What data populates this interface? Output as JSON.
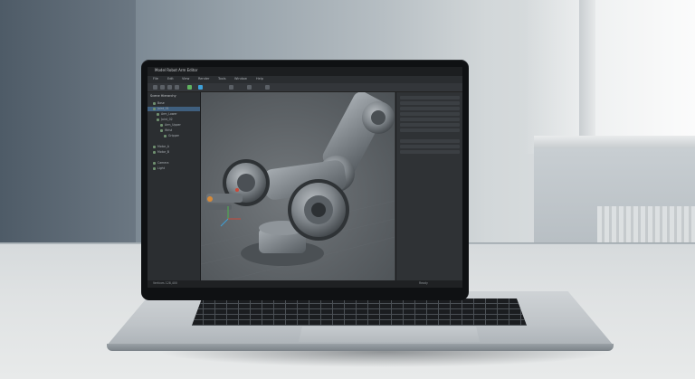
{
  "screen_app": {
    "title": "Model Robot Arm Editor",
    "menu_items": [
      "File",
      "Edit",
      "View",
      "Render",
      "Tools",
      "Window",
      "Help"
    ],
    "outliner": {
      "header": "Scene Hierarchy",
      "items": [
        "Base",
        "Joint_01",
        "Arm_Lower",
        "Joint_02",
        "Arm_Upper",
        "Wrist",
        "Gripper",
        "Motor_A",
        "Motor_B",
        "Camera",
        "Light"
      ]
    },
    "status_left": "Vertices 128,400",
    "status_right": "Ready"
  },
  "colors": {
    "accent": "#3ea0d8",
    "selected": "#3f5f7e",
    "model": "#8b9095"
  }
}
